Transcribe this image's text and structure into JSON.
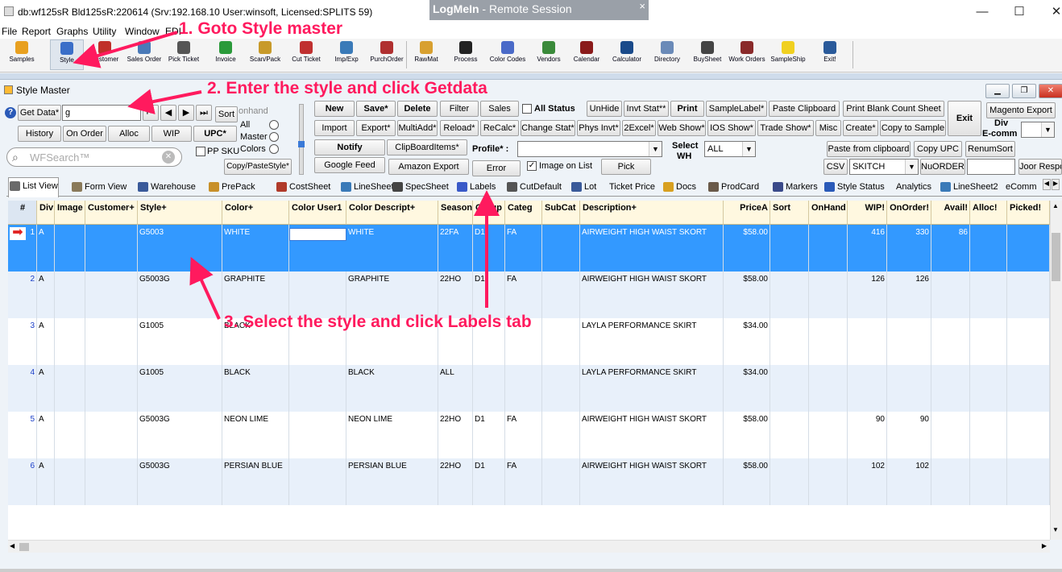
{
  "window": {
    "title": "db:wf125sR Bld125sR:220614 (Srv:192.168.10 User:winsoft, Licensed:SPLITS 59)",
    "minimize": "—",
    "maximize": "☐",
    "close": "✕"
  },
  "logmein": {
    "brand": "LogMeIn",
    "sep": " - ",
    "session": "Remote Session",
    "close": "×"
  },
  "menu": [
    "File",
    "Report",
    "Graphs",
    "Utility",
    "Window",
    "EDI"
  ],
  "toolbar": [
    {
      "label": "Samples",
      "icon": "samples-icon",
      "color": "#e8a020"
    },
    {
      "label": "Style",
      "icon": "style-icon",
      "color": "#3a6ec8"
    },
    {
      "label": "Customer",
      "icon": "customer-icon",
      "color": "#c0302a"
    },
    {
      "label": "Sales Order",
      "icon": "sales-order-icon",
      "color": "#4a7ab8"
    },
    {
      "label": "Pick Ticket",
      "icon": "pick-ticket-icon",
      "color": "#555"
    },
    {
      "label": "Invoice",
      "icon": "invoice-icon",
      "color": "#2a9a3a"
    },
    {
      "label": "Scan/Pack",
      "icon": "scan-pack-icon",
      "color": "#c89a2a"
    },
    {
      "label": "Cut Ticket",
      "icon": "cut-ticket-icon",
      "color": "#c03030"
    },
    {
      "label": "Imp/Exp",
      "icon": "import-export-icon",
      "color": "#3a7ab8"
    },
    {
      "label": "PurchOrder",
      "icon": "purchase-order-icon",
      "color": "#b03030"
    },
    {
      "label": "RawMat",
      "icon": "raw-material-icon",
      "color": "#d8a030"
    },
    {
      "label": "Process",
      "icon": "process-icon",
      "color": "#222"
    },
    {
      "label": "Color Codes",
      "icon": "color-codes-icon",
      "color": "#4a6ac8"
    },
    {
      "label": "Vendors",
      "icon": "vendors-icon",
      "color": "#3a8a3a"
    },
    {
      "label": "Calendar",
      "icon": "calendar-icon",
      "color": "#8a1a1a"
    },
    {
      "label": "Calculator",
      "icon": "calculator-icon",
      "color": "#1a4a8a"
    },
    {
      "label": "Directory",
      "icon": "directory-icon",
      "color": "#6a8ab8"
    },
    {
      "label": "BuySheet",
      "icon": "buysheet-icon",
      "color": "#444"
    },
    {
      "label": "Work Orders",
      "icon": "work-orders-icon",
      "color": "#8a2a2a"
    },
    {
      "label": "SampleShip",
      "icon": "sample-ship-icon",
      "color": "#f0d020"
    },
    {
      "label": "Exit!",
      "icon": "exit-icon",
      "color": "#2a5a9a"
    }
  ],
  "styleMaster": {
    "title": "Style Master",
    "getData": "Get Data*",
    "styleValue": "g",
    "sort": "Sort",
    "onhand": "onhand",
    "all": "All",
    "master": "Master",
    "colors": "Colors",
    "history": "History",
    "onOrder": "On Order",
    "alloc": "Alloc",
    "wip": "WIP",
    "upc": "UPC*",
    "ppSku": "PP SKU",
    "copyPaste": "Copy/PasteStyle*",
    "searchPlaceholder": "WFSearch™",
    "row1": [
      "New",
      "Save*",
      "Delete",
      "Filter",
      "Sales"
    ],
    "allStatus": "All Status",
    "unhide": "UnHide",
    "invtStat": "Invt Stat**",
    "print": "Print",
    "sampleLabel": "SampleLabel*",
    "pasteClipboard": "Paste Clipboard",
    "printBlank": "Print Blank Count Sheet",
    "row2": [
      "Import",
      "Export*",
      "MultiAdd*",
      "Reload*",
      "ReCalc*",
      "Change Stat*",
      "Phys Invt*",
      "2Excel*",
      "Web Show*",
      "IOS Show*",
      "Trade Show*",
      "Misc",
      "Create*",
      "Copy to Sample"
    ],
    "exit": "Exit",
    "magentoExport": "Magento Export",
    "divEcomm1": "Div",
    "divEcomm2": "E-comm",
    "notify": "Notify",
    "clipboardItems": "ClipBoardItems*",
    "profile": "Profile* :",
    "selectWh1": "Select",
    "selectWh2": "WH",
    "wh": "ALL",
    "pasteFromClipboard": "Paste from clipboard",
    "copyUpc": "Copy UPC",
    "renumSort": "RenumSort",
    "googleFeed": "Google Feed",
    "amazonExport": "Amazon Export",
    "error": "Error",
    "imageOnList": "Image on List",
    "pick": "Pick",
    "csv": "CSV",
    "skitch": "SKITCH",
    "nuOrder": "NuORDER*",
    "joor": "Joor Respo"
  },
  "tabs": [
    {
      "label": "List View",
      "icon": "list-view-icon",
      "color": "#6a6a6a"
    },
    {
      "label": "Form View",
      "icon": "form-view-icon",
      "color": "#8a7a5a"
    },
    {
      "label": "Warehouse",
      "icon": "warehouse-icon",
      "color": "#3a5a9a"
    },
    {
      "label": "PrePack",
      "icon": "prepack-icon",
      "color": "#c8902a"
    },
    {
      "label": "CostSheet",
      "icon": "costsheet-icon",
      "color": "#b03a2a"
    },
    {
      "label": "LineSheet",
      "icon": "linesheet-icon",
      "color": "#3a7ab8"
    },
    {
      "label": "SpecSheet",
      "icon": "specsheet-icon",
      "color": "#444"
    },
    {
      "label": "Labels",
      "icon": "labels-icon",
      "color": "#3a5ac8"
    },
    {
      "label": "CutDefault",
      "icon": "cutdefault-icon",
      "color": "#555"
    },
    {
      "label": "Lot",
      "icon": "lot-icon",
      "color": "#3a5a9a"
    },
    {
      "label": "Ticket Price",
      "icon": "",
      "color": ""
    },
    {
      "label": "Docs",
      "icon": "docs-icon",
      "color": "#d8a020"
    },
    {
      "label": "ProdCard",
      "icon": "prodcard-icon",
      "color": "#6a5a4a"
    },
    {
      "label": "Markers",
      "icon": "markers-icon",
      "color": "#3a4a8a"
    },
    {
      "label": "Style Status",
      "icon": "style-status-icon",
      "color": "#2a5ab8"
    },
    {
      "label": "Analytics",
      "icon": "",
      "color": ""
    },
    {
      "label": "LineSheet2",
      "icon": "linesheet2-icon",
      "color": "#3a7ab8"
    },
    {
      "label": "eComm",
      "icon": "",
      "color": ""
    }
  ],
  "grid": {
    "columns": [
      "#",
      "Div",
      "Image",
      "Customer+",
      "Style+",
      "Color+",
      "Color User1",
      "Color Descript+",
      "Season",
      "Group",
      "Categ",
      "SubCat",
      "Description+",
      "PriceA",
      "Sort",
      "OnHand",
      "WIP!",
      "OnOrder!",
      "Avail!",
      "Alloc!",
      "Picked!"
    ],
    "rows": [
      {
        "n": "1",
        "div": "A",
        "style": "G5003",
        "color": "WHITE",
        "colorUser1": "",
        "colorDesc": "WHITE",
        "season": "22FA",
        "group": "D1",
        "categ": "FA",
        "desc": "AIRWEIGHT HIGH WAIST SKORT",
        "price": "$58.00",
        "wip": "416",
        "onOrder": "330",
        "avail": "86"
      },
      {
        "n": "2",
        "div": "A",
        "style": "G5003G",
        "color": "GRAPHITE",
        "colorUser1": "",
        "colorDesc": "GRAPHITE",
        "season": "22HO",
        "group": "D1",
        "categ": "FA",
        "desc": "AIRWEIGHT HIGH WAIST SKORT",
        "price": "$58.00",
        "wip": "126",
        "onOrder": "126",
        "avail": ""
      },
      {
        "n": "3",
        "div": "A",
        "style": "G1005",
        "color": "BLACK",
        "colorUser1": "",
        "colorDesc": "",
        "season": "",
        "group": "",
        "categ": "",
        "desc": "LAYLA PERFORMANCE SKIRT",
        "price": "$34.00",
        "wip": "",
        "onOrder": "",
        "avail": ""
      },
      {
        "n": "4",
        "div": "A",
        "style": "G1005",
        "color": "BLACK",
        "colorUser1": "",
        "colorDesc": "BLACK",
        "season": "ALL",
        "group": "",
        "categ": "",
        "desc": "LAYLA PERFORMANCE SKIRT",
        "price": "$34.00",
        "wip": "",
        "onOrder": "",
        "avail": ""
      },
      {
        "n": "5",
        "div": "A",
        "style": "G5003G",
        "color": "NEON LIME",
        "colorUser1": "",
        "colorDesc": "NEON LIME",
        "season": "22HO",
        "group": "D1",
        "categ": "FA",
        "desc": "AIRWEIGHT HIGH WAIST SKORT",
        "price": "$58.00",
        "wip": "90",
        "onOrder": "90",
        "avail": ""
      },
      {
        "n": "6",
        "div": "A",
        "style": "G5003G",
        "color": "PERSIAN BLUE",
        "colorUser1": "",
        "colorDesc": "PERSIAN BLUE",
        "season": "22HO",
        "group": "D1",
        "categ": "FA",
        "desc": "AIRWEIGHT HIGH WAIST SKORT",
        "price": "$58.00",
        "wip": "102",
        "onOrder": "102",
        "avail": ""
      }
    ]
  },
  "annotations": {
    "a1": "1. Goto Style master",
    "a2": "2. Enter the style and click Getdata",
    "a3": "3. Select the style and click Labels tab"
  },
  "colors": {
    "selectedRow": "#3399ff",
    "altRow": "#e8f0fa",
    "annotation": "#ff1a5e",
    "rowNumber": "#1a3ec8"
  }
}
